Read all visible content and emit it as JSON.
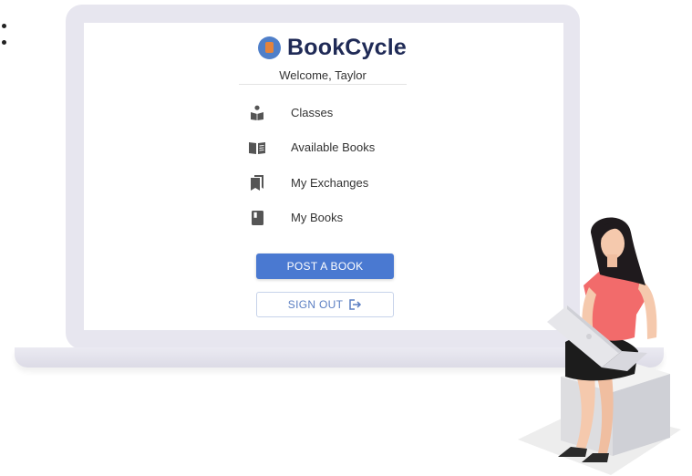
{
  "app": {
    "name": "BookCycle",
    "welcome": "Welcome, Taylor"
  },
  "nav": {
    "items": [
      {
        "label": "Classes",
        "icon": "student-reading-icon"
      },
      {
        "label": "Available Books",
        "icon": "open-book-icon"
      },
      {
        "label": "My Exchanges",
        "icon": "bookmarks-icon"
      },
      {
        "label": "My Books",
        "icon": "book-icon"
      }
    ]
  },
  "actions": {
    "post_label": "POST A BOOK",
    "signout_label": "SIGN OUT"
  },
  "colors": {
    "primary": "#4a79d1",
    "brand_text": "#1f2a56",
    "logo_accent": "#e5833b"
  }
}
